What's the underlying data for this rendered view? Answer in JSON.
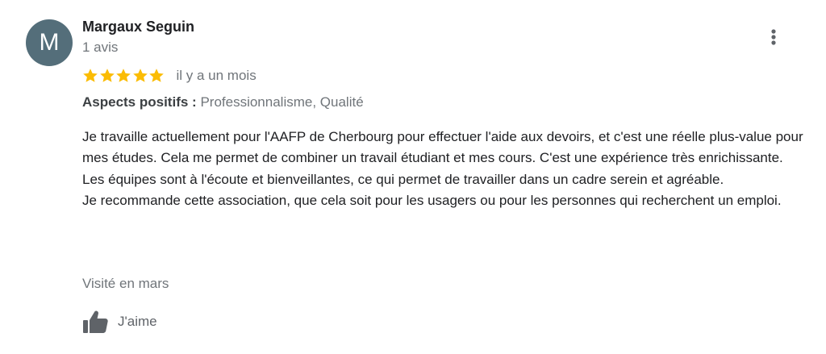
{
  "author": {
    "initial": "M",
    "name": "Margaux Seguin",
    "review_count": "1 avis",
    "avatar_color": "#546e7a"
  },
  "review": {
    "rating": 5,
    "rating_max": 5,
    "star_color": "#fbbc04",
    "date": "il y a un mois",
    "aspects_label": "Aspects positifs :",
    "aspects_value": "Professionnalisme, Qualité",
    "paragraphs": [
      "Je travaille actuellement pour l'AAFP de Cherbourg pour effectuer l'aide aux devoirs, et c'est une réelle plus-value pour mes études. Cela me permet de combiner un travail étudiant et mes cours. C'est une expérience très enrichissante.",
      "Les équipes sont à l'écoute et bienveillantes, ce qui permet de travailler dans un cadre serein et agréable.",
      "Je recommande cette association, que cela soit pour les usagers ou pour les personnes qui recherchent un emploi."
    ],
    "visit": "Visité en mars"
  },
  "actions": {
    "like_label": "J'aime",
    "like_icon": "thumbs-up-icon",
    "more_icon": "more-vert-icon"
  }
}
